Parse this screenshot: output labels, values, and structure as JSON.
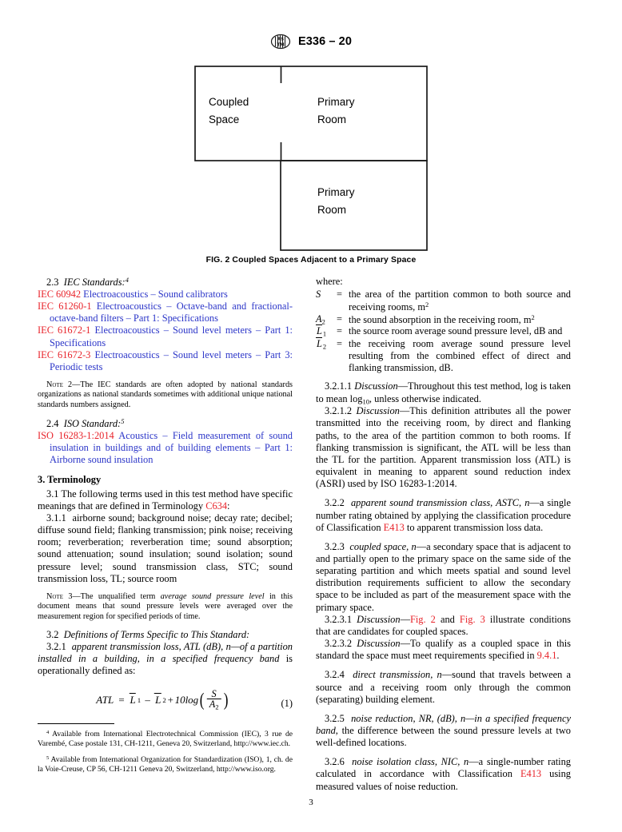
{
  "header": {
    "logo_icon": "astm-logo-icon",
    "designation": "E336 – 20"
  },
  "figure": {
    "labels": {
      "coupled_space_line1": "Coupled",
      "coupled_space_line2": "Space",
      "primary_room_top_line1": "Primary",
      "primary_room_top_line2": "Room",
      "primary_room_bottom_line1": "Primary",
      "primary_room_bottom_line2": "Room"
    },
    "caption": "FIG. 2 Coupled Spaces Adjacent to a Primary Space"
  },
  "left_column": {
    "sec_2_3": {
      "number": "2.3",
      "title": "IEC Standards:",
      "footnote_marker": "4"
    },
    "iec_standards": [
      {
        "id": "IEC 60942",
        "title": "Electroacoustics – Sound calibrators"
      },
      {
        "id": "IEC 61260-1",
        "title": "Electroacoustics – Octave-band and fractional-octave-band filters – Part 1: Specifications"
      },
      {
        "id": "IEC 61672-1",
        "title": "Electroacoustics – Sound level meters – Part 1: Specifications"
      },
      {
        "id": "IEC 61672-3",
        "title": "Electroacoustics – Sound level meters – Part 3: Periodic tests"
      }
    ],
    "note2": {
      "label": "Note",
      "number": "2—",
      "text": "The IEC standards are often adopted by national standards organizations as national standards sometimes with additional unique national standards numbers assigned."
    },
    "sec_2_4": {
      "number": "2.4",
      "title": "ISO Standard:",
      "footnote_marker": "5"
    },
    "iso_standard": {
      "id": "ISO 16283-1:2014",
      "title": "Acoustics – Field measurement of sound insulation in buildings and of building elements – Part 1: Airborne sound insulation"
    },
    "sec_3": {
      "heading": "3.  Terminology",
      "p_3_1_num": "3.1",
      "p_3_1_text_a": "The following terms used in this test method have specific meanings that are defined in Terminology ",
      "p_3_1_link": "C634",
      "p_3_1_text_b": ":",
      "p_3_1_1_num": "3.1.1",
      "p_3_1_1_text": "airborne sound; background noise; decay rate; decibel; diffuse sound field; flanking transmission; pink noise; receiving room; reverberation; reverberation time; sound absorption; sound attenuation; sound insulation; sound isolation; sound pressure level; sound transmission class, STC; sound transmission loss, TL; source room"
    },
    "note3": {
      "label": "Note",
      "number": "3—",
      "text_a": "The unqualified term ",
      "italic_term": "average sound pressure level",
      "text_b": " in this document means that sound pressure levels were averaged over the measurement region for specified periods of time."
    },
    "sec_3_2": {
      "number": "3.2",
      "title": "Definitions of Terms Specific to This Standard:"
    },
    "p_3_2_1": {
      "number": "3.2.1",
      "term": "apparent transmission loss, ATL (dB), n—of a partition installed in a building, in a specified frequency band",
      "tail": " is operationally defined as:"
    },
    "equation": {
      "lhs": "ATL",
      "eq": "=",
      "l1": "L",
      "l1_sub": "1",
      "minus": "–",
      "l2": "L",
      "l2_sub": "2",
      "plus": "+",
      "log": "10log",
      "numerator": "S",
      "denominator": "A",
      "denominator_sub": "2",
      "number": "(1)"
    },
    "footnotes": [
      {
        "marker": "4",
        "text": "Available from International Electrotechnical Commission (IEC), 3 rue de Varembé, Case postale 131, CH-1211, Geneva 20, Switzerland, http://www.iec.ch."
      },
      {
        "marker": "5",
        "text": "Available from International Organization for Standardization (ISO), 1, ch. de la Voie-Creuse, CP 56, CH-1211 Geneva 20, Switzerland, http://www.iso.org."
      }
    ]
  },
  "right_column": {
    "where_label": "where:",
    "where_rows": [
      {
        "symbol": "S",
        "symbol_sub": "",
        "overline": false,
        "eq": "=",
        "definition": "the area of the partition common to both source and receiving rooms, m",
        "sup": "2"
      },
      {
        "symbol": "A",
        "symbol_sub": "2",
        "overline": false,
        "eq": "=",
        "definition": "the sound absorption in the receiving room, m",
        "sup": "2"
      },
      {
        "symbol": "L",
        "symbol_sub": "1",
        "overline": true,
        "eq": "=",
        "definition": "the source room average sound pressure level, dB and",
        "sup": ""
      },
      {
        "symbol": "L",
        "symbol_sub": "2",
        "overline": true,
        "eq": "=",
        "definition": "the receiving room average sound pressure level resulting from the combined effect of direct and flanking transmission, dB.",
        "sup": ""
      }
    ],
    "p_3_2_1_1": {
      "number": "3.2.1.1",
      "label": "Discussion",
      "text_a": "—Throughout this test method, log is taken to mean log",
      "sub": "10",
      "text_b": ", unless otherwise indicated."
    },
    "p_3_2_1_2": {
      "number": "3.2.1.2",
      "label": "Discussion",
      "text": "—This definition attributes all the power transmitted into the receiving room, by direct and flanking paths, to the area of the partition common to both rooms. If flanking transmission is significant, the ATL will be less than the TL for the partition. Apparent transmission loss (ATL) is equivalent in meaning to apparent sound reduction index (ASRI) used by ISO 16283-1:2014."
    },
    "p_3_2_2": {
      "number": "3.2.2",
      "term": "apparent sound transmission class, ASTC, n",
      "text_a": "—a single number rating obtained by applying the classification procedure of Classification ",
      "link": "E413",
      "text_b": " to apparent transmission loss data."
    },
    "p_3_2_3": {
      "number": "3.2.3",
      "term": "coupled space, n",
      "text": "—a secondary space that is adjacent to and partially open to the primary space on the same side of the separating partition and which meets spatial and sound level distribution requirements sufficient to allow the secondary space to be included as part of the measurement space with the primary space."
    },
    "p_3_2_3_1": {
      "number": "3.2.3.1",
      "label": "Discussion",
      "text_a": "—",
      "link1": "Fig. 2",
      "text_b": " and ",
      "link2": "Fig. 3",
      "text_c": " illustrate conditions that are candidates for coupled spaces."
    },
    "p_3_2_3_2": {
      "number": "3.2.3.2",
      "label": "Discussion",
      "text_a": "—To qualify as a coupled space in this standard the space must meet requirements specified in ",
      "link": "9.4.1",
      "text_b": "."
    },
    "p_3_2_4": {
      "number": "3.2.4",
      "term": "direct transmission, n",
      "text": "—sound that travels between a source and a receiving room only through the common (separating) building element."
    },
    "p_3_2_5": {
      "number": "3.2.5",
      "term": "noise reduction, NR, (dB), n—in a specified frequency band",
      "text": ", the difference between the sound pressure levels at two well-defined locations."
    },
    "p_3_2_6": {
      "number": "3.2.6",
      "term": "noise isolation class, NIC, n",
      "text_a": "—a single-number rating calculated in accordance with Classification ",
      "link": "E413",
      "text_b": " using measured values of noise reduction."
    }
  },
  "footer": {
    "page_number": "3"
  },
  "colors": {
    "link_red": "#e8232a",
    "link_blue": "#2b35c8",
    "text": "#000000",
    "rule": "#000000"
  }
}
